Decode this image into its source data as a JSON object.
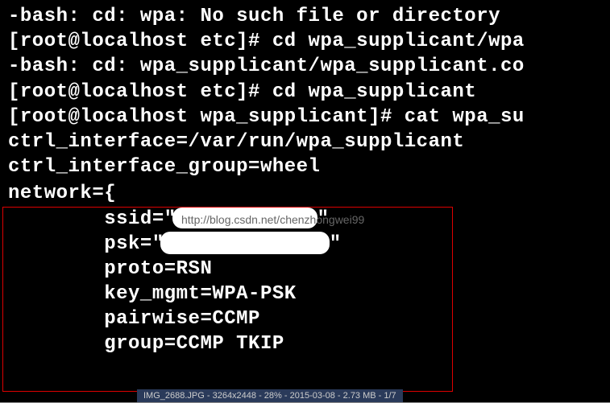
{
  "terminal": {
    "lines": [
      "-bash: cd: wpa: No such file or directory",
      "[root@localhost etc]# cd wpa_supplicant/wpa",
      "-bash: cd: wpa_supplicant/wpa_supplicant.co",
      "[root@localhost etc]# cd wpa_supplicant",
      "[root@localhost wpa_supplicant]# cat wpa_su",
      "ctrl_interface=/var/run/wpa_supplicant",
      "ctrl_interface_group=wheel"
    ],
    "network": {
      "open": "network={",
      "ssid_prefix": "        ssid=\"",
      "ssid_suffix": "\"",
      "psk_prefix": "        psk=\"",
      "psk_suffix": "\"",
      "proto": "        proto=RSN",
      "key_mgmt": "        key_mgmt=WPA-PSK",
      "pairwise": "        pairwise=CCMP",
      "group": "        group=CCMP TKIP"
    }
  },
  "watermark": "http://blog.csdn.net/chenzhongwei99",
  "status_bar": "IMG_2688.JPG - 3264x2448 - 28% - 2015-03-08 - 2.73 MB - 1/7"
}
